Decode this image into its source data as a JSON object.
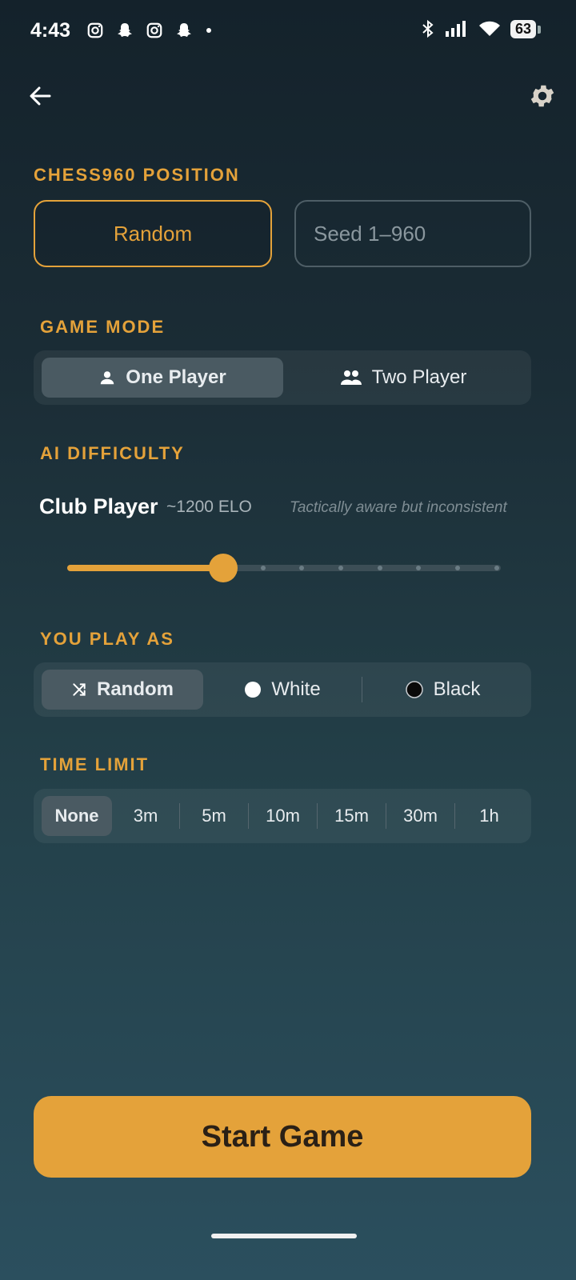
{
  "status_bar": {
    "time": "4:43",
    "battery": "63",
    "left_icons": [
      "instagram-icon",
      "snapchat-icon",
      "instagram-icon",
      "snapchat-icon",
      "dot-icon"
    ],
    "right_icons": [
      "bluetooth-icon",
      "signal-icon",
      "wifi-icon",
      "battery-icon"
    ]
  },
  "header": {
    "back_icon": "back-arrow-icon",
    "settings_icon": "gear-icon"
  },
  "position": {
    "label": "CHESS960 POSITION",
    "random_label": "Random",
    "seed_placeholder": "Seed 1–960"
  },
  "game_mode": {
    "label": "GAME MODE",
    "options": [
      {
        "label": "One Player",
        "icon": "person-icon",
        "active": true
      },
      {
        "label": "Two Player",
        "icon": "people-icon",
        "active": false
      }
    ]
  },
  "ai": {
    "label": "AI DIFFICULTY",
    "level_name": "Club Player",
    "elo": "~1200 ELO",
    "description": "Tactically aware but inconsistent",
    "slider_value": 0.36
  },
  "play_as": {
    "label": "YOU PLAY AS",
    "options": [
      {
        "label": "Random",
        "icon": "shuffle-icon",
        "active": true
      },
      {
        "label": "White",
        "icon": "white-circle-icon",
        "active": false
      },
      {
        "label": "Black",
        "icon": "black-circle-icon",
        "active": false
      }
    ]
  },
  "time_limit": {
    "label": "TIME LIMIT",
    "options": [
      "None",
      "3m",
      "5m",
      "10m",
      "15m",
      "30m",
      "1h"
    ],
    "selected": "None"
  },
  "start_button": "Start Game",
  "colors": {
    "accent": "#e4a23a",
    "active_segment": "#4a5a62"
  }
}
